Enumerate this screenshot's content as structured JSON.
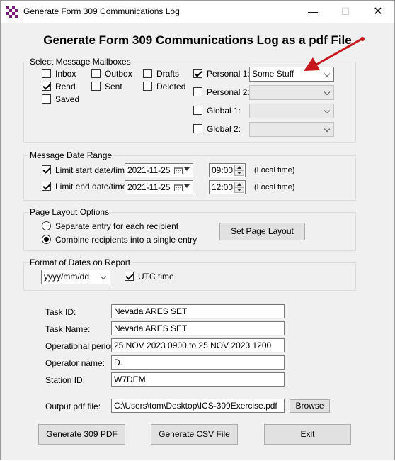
{
  "window": {
    "title": "Generate Form 309 Communications Log"
  },
  "heading": "Generate Form 309 Communications Log as a pdf File",
  "mailboxes": {
    "group_title": "Select Message Mailboxes",
    "inbox": {
      "label": "Inbox",
      "checked": false
    },
    "outbox": {
      "label": "Outbox",
      "checked": false
    },
    "drafts": {
      "label": "Drafts",
      "checked": false
    },
    "read": {
      "label": "Read",
      "checked": true
    },
    "sent": {
      "label": "Sent",
      "checked": false
    },
    "deleted": {
      "label": "Deleted",
      "checked": false
    },
    "saved": {
      "label": "Saved",
      "checked": false
    },
    "personal1": {
      "label": "Personal 1:",
      "checked": true,
      "value": "Some Stuff"
    },
    "personal2": {
      "label": "Personal 2:",
      "checked": false,
      "value": ""
    },
    "global1": {
      "label": "Global 1:",
      "checked": false,
      "value": ""
    },
    "global2": {
      "label": "Global 2:",
      "checked": false,
      "value": ""
    }
  },
  "date_range": {
    "group_title": "Message Date Range",
    "start": {
      "label": "Limit start date/time:",
      "checked": true,
      "date": "2021-11-25",
      "time": "09:00",
      "note": "(Local time)"
    },
    "end": {
      "label": "Limit end date/time:",
      "checked": true,
      "date": "2021-11-25",
      "time": "12:00",
      "note": "(Local time)"
    }
  },
  "layout": {
    "group_title": "Page Layout Options",
    "separate": {
      "label": "Separate entry for each recipient",
      "selected": false
    },
    "combine": {
      "label": "Combine recipients into a single entry",
      "selected": true
    },
    "set_button": "Set Page Layout"
  },
  "date_format": {
    "group_title": "Format of Dates on Report",
    "format": "yyyy/mm/dd",
    "utc": {
      "label": "UTC time",
      "checked": true
    }
  },
  "form": {
    "task_id": {
      "label": "Task ID:",
      "value": "Nevada ARES SET"
    },
    "task_name": {
      "label": "Task Name:",
      "value": "Nevada ARES SET"
    },
    "op_period": {
      "label": "Operational period:",
      "value": "25 NOV 2023 0900 to 25 NOV 2023 1200"
    },
    "operator": {
      "label": "Operator name:",
      "value": "D."
    },
    "station": {
      "label": "Station ID:",
      "value": "W7DEM"
    },
    "output": {
      "label": "Output pdf file:",
      "value": "C:\\Users\\tom\\Desktop\\ICS-309Exercise.pdf",
      "browse": "Browse"
    }
  },
  "buttons": {
    "generate_pdf": "Generate 309 PDF",
    "generate_csv": "Generate CSV File",
    "exit": "Exit"
  },
  "colors": {
    "annotation_arrow": "#c8171e"
  }
}
